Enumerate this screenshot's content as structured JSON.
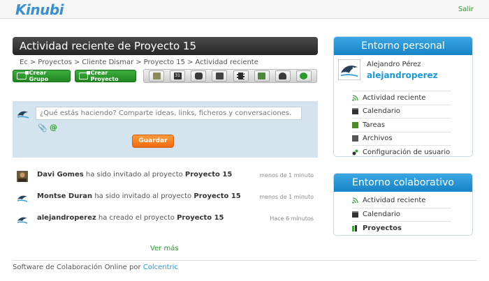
{
  "header": {
    "logo": "Kinubi",
    "logout": "Salir"
  },
  "main": {
    "title": "Actividad reciente de Proyecto 15",
    "breadcrumb": [
      "Ec",
      "Proyectos",
      "Cliente Dismar",
      "Proyecto 15",
      "Actividad reciente"
    ],
    "buttons": {
      "create_group": "Crear Grupo",
      "create_project": "Crear Proyecto"
    },
    "toolbar_icons": [
      "list-icon",
      "calendar-icon",
      "chat-icon",
      "document-icon",
      "film-icon",
      "folder-icon",
      "users-icon",
      "settings-icon"
    ],
    "status": {
      "placeholder": "¿Qué estás haciendo? Comparte ideas, links, ficheros y conversaciones.",
      "save": "Guardar"
    },
    "feed": [
      {
        "user": "Davi Gomes",
        "action": " ha sido invitado al proyecto ",
        "target": "Proyecto 15",
        "time": "menos de 1 minuto"
      },
      {
        "user": "Montse Duran",
        "action": " ha sido invitado al proyecto ",
        "target": "Proyecto 15",
        "time": "menos de 1 minuto"
      },
      {
        "user": "alejandroperez",
        "action": " ha creado el proyecto ",
        "target": "Proyecto 15",
        "time": "Hace 6 minutos"
      }
    ],
    "more": "Ver más"
  },
  "footer": {
    "text": "Software de Colaboración Online por ",
    "link": "Colcentric"
  },
  "personal": {
    "title": "Entorno personal",
    "user_name": "Alejandro Pérez",
    "user_handle": "alejandroperez",
    "items": [
      "Actividad reciente",
      "Calendario",
      "Tareas",
      "Archivos",
      "Configuración de usuario"
    ]
  },
  "collab": {
    "title": "Entorno colaborativo",
    "items": [
      "Actividad reciente",
      "Calendario",
      "Proyectos"
    ]
  },
  "colors": {
    "brand": "#1c9ad6",
    "green": "#2a9a2a",
    "orange": "#f06a10",
    "dark": "#333333"
  }
}
